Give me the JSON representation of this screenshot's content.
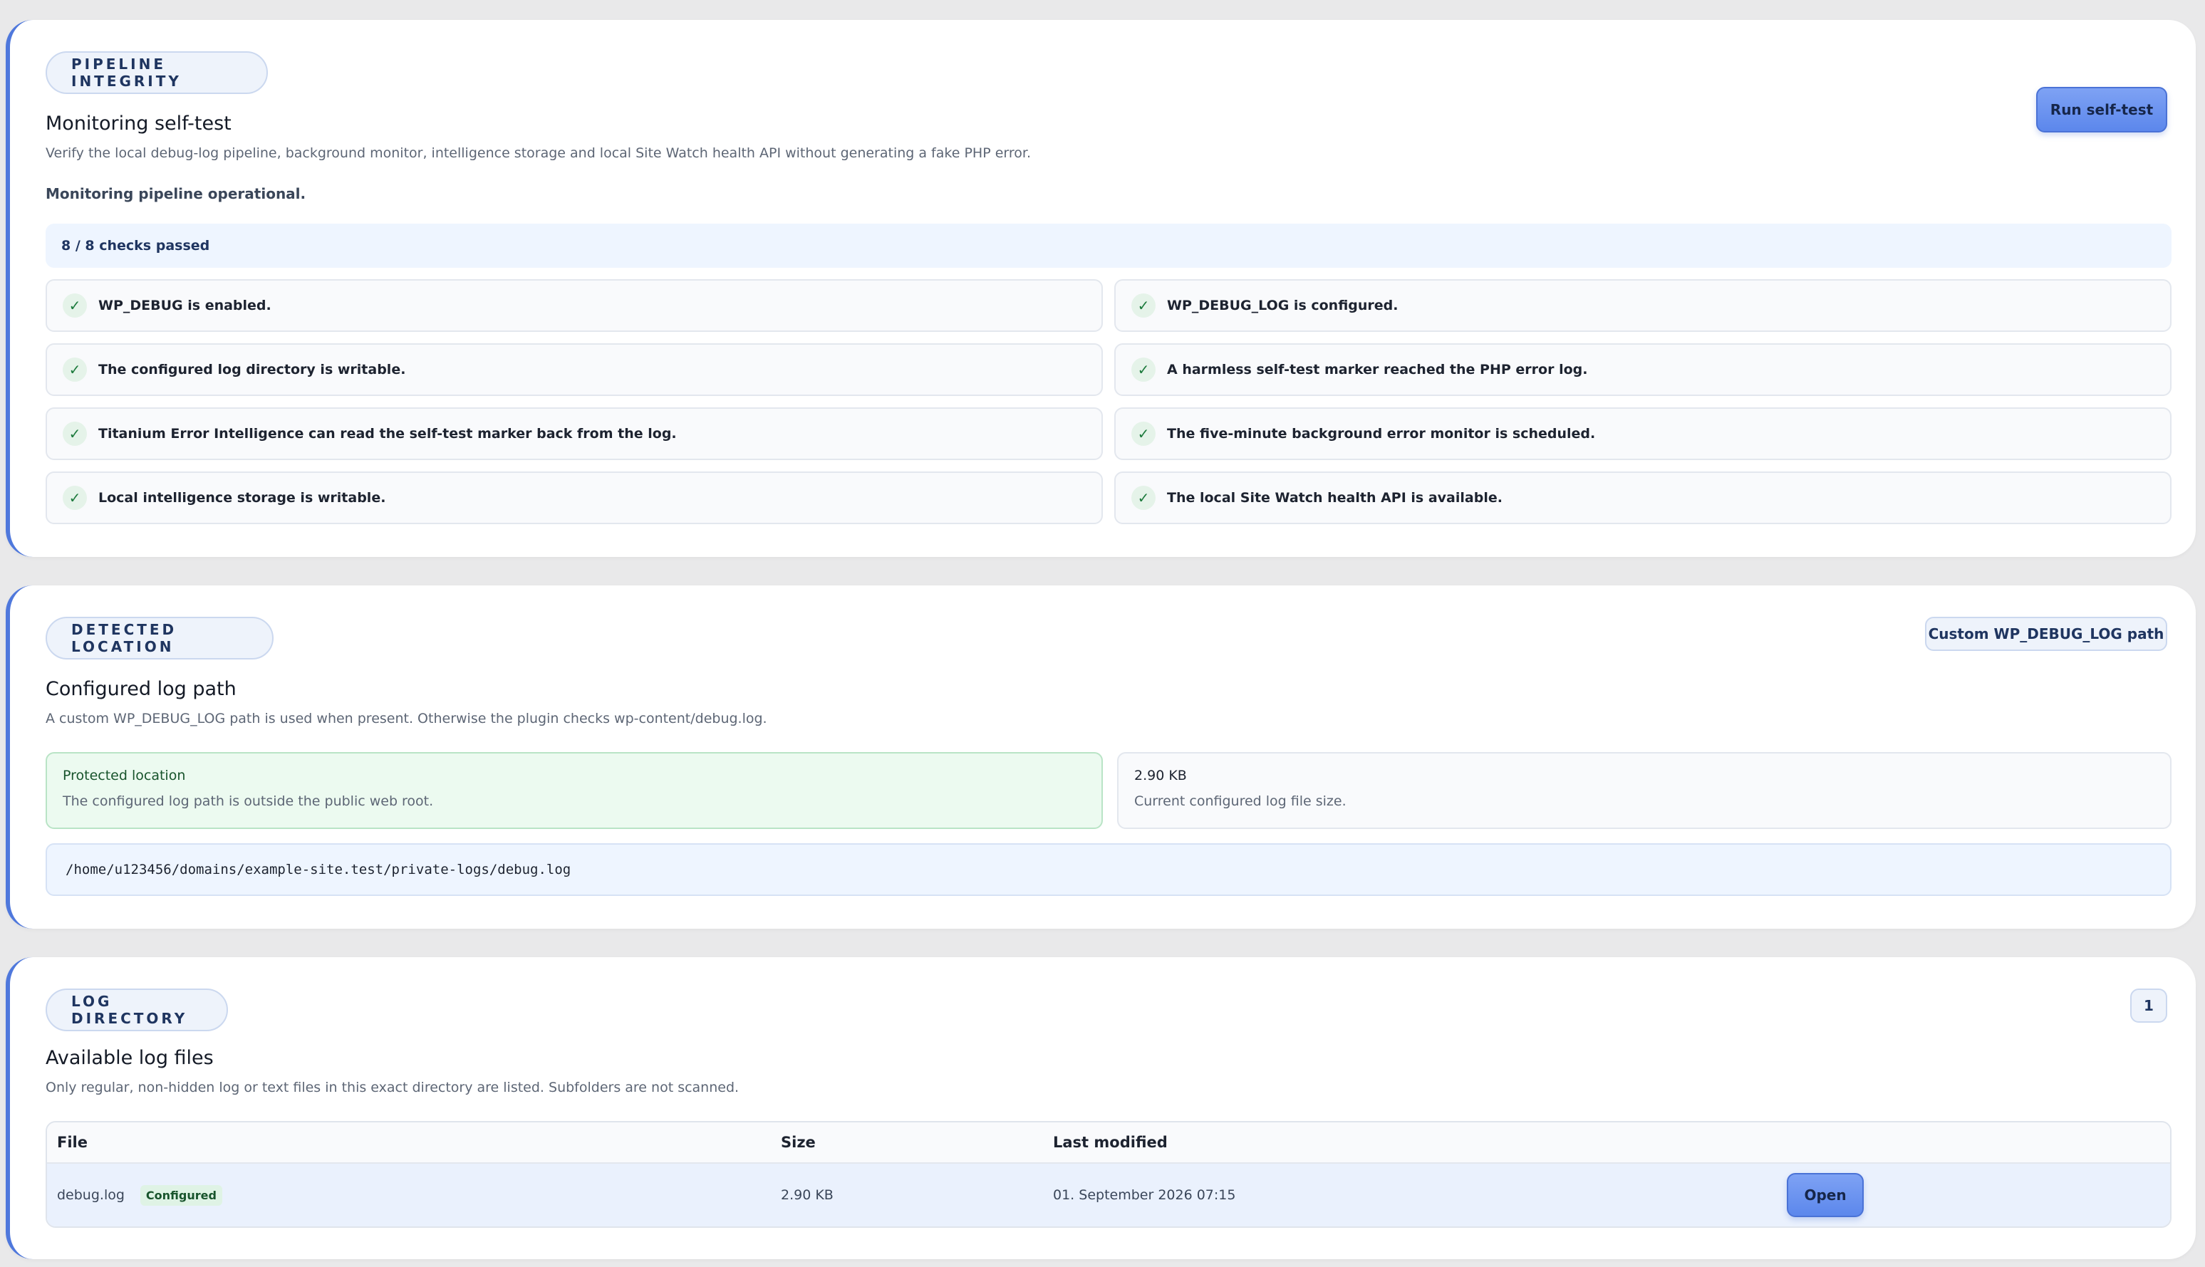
{
  "integrity": {
    "eyebrow": "PIPELINE INTEGRITY",
    "title": "Monitoring self-test",
    "description": "Verify the local debug-log pipeline, background monitor, intelligence storage and local Site Watch health API without generating a fake PHP error.",
    "run_button": "Run self-test",
    "status": "Monitoring pipeline operational.",
    "summary": "8 / 8 checks passed",
    "checks": [
      "WP_DEBUG is enabled.",
      "WP_DEBUG_LOG is configured.",
      "The configured log directory is writable.",
      "A harmless self-test marker reached the PHP error log.",
      "Titanium Error Intelligence can read the self-test marker back from the log.",
      "The five-minute background error monitor is scheduled.",
      "Local intelligence storage is writable.",
      "The local Site Watch health API is available."
    ],
    "check_glyph": "✓"
  },
  "location": {
    "eyebrow": "DETECTED LOCATION",
    "title": "Configured log path",
    "description": "A custom WP_DEBUG_LOG path is used when present. Otherwise the plugin checks wp-content/debug.log.",
    "badge": "Custom WP_DEBUG_LOG path",
    "protected_title": "Protected location",
    "protected_text": "The configured log path is outside the public web root.",
    "size_value": "2.90 KB",
    "size_text": "Current configured log file size.",
    "path": "/home/u123456/domains/example-site.test/private-logs/debug.log"
  },
  "directory": {
    "eyebrow": "LOG DIRECTORY",
    "title": "Available log files",
    "description": "Only regular, non-hidden log or text files in this exact directory are listed. Subfolders are not scanned.",
    "count": "1",
    "columns": {
      "file": "File",
      "size": "Size",
      "modified": "Last modified"
    },
    "rows": [
      {
        "file": "debug.log",
        "tag": "Configured",
        "size": "2.90 KB",
        "modified": "01. September 2026 07:15",
        "action": "Open"
      }
    ]
  },
  "colors": {
    "accent": "#4f78dc",
    "success": "#1c7a3c",
    "background": "#e9e9ea"
  }
}
